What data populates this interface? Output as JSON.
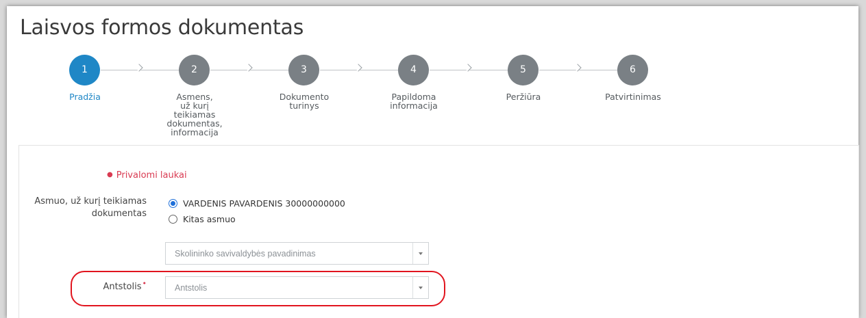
{
  "page": {
    "title": "Laisvos formos dokumentas"
  },
  "stepper": {
    "steps": [
      {
        "number": "1",
        "label": "Pradžia",
        "active": true
      },
      {
        "number": "2",
        "label": "Asmens,\nuž kurį\nteikiamas\ndokumentas,\ninformacija",
        "active": false
      },
      {
        "number": "3",
        "label": "Dokumento\nturinys",
        "active": false
      },
      {
        "number": "4",
        "label": "Papildoma\ninformacija",
        "active": false
      },
      {
        "number": "5",
        "label": "Peržiūra",
        "active": false
      },
      {
        "number": "6",
        "label": "Patvirtinimas",
        "active": false
      }
    ]
  },
  "form": {
    "required_note": "Privalomi laukai",
    "person_field": {
      "label": "Asmuo, už kurį teikiamas dokumentas",
      "options": [
        {
          "label": "VARDENIS PAVARDENIS 30000000000",
          "checked": true
        },
        {
          "label": "Kitas asmuo",
          "checked": false
        }
      ]
    },
    "municipality_select": {
      "placeholder": "Skolininko savivaldybės pavadinimas"
    },
    "bailiff_field": {
      "label": "Antstolis",
      "required_mark": "•",
      "placeholder": "Antstolis"
    }
  },
  "colors": {
    "active_step": "#1f87c6",
    "inactive_step": "#7a8085",
    "required": "#d93b52",
    "highlight": "#e1141e"
  }
}
